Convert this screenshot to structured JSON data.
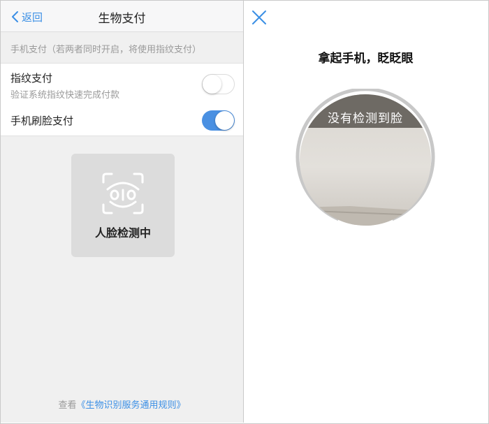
{
  "left_panel": {
    "nav": {
      "back_label": "返回",
      "title": "生物支付"
    },
    "section_hint": "手机支付（若两者同时开启，将使用指纹支付）",
    "fingerprint": {
      "title": "指纹支付",
      "subtitle": "验证系统指纹快速完成付款",
      "enabled": false
    },
    "face": {
      "title": "手机刷脸支付",
      "enabled": true
    },
    "face_card": {
      "icon": "face-scan-icon",
      "label": "人脸检测中"
    },
    "footer": {
      "prefix": "查看",
      "link": "《生物识别服务通用规则》"
    }
  },
  "right_panel": {
    "close_icon": "close-icon",
    "prompt": "拿起手机，眨眨眼",
    "camera_status": "没有检测到脸"
  },
  "colors": {
    "accent": "#3b8fe5",
    "toggle_on": "#4a90e2",
    "panel_bg": "#f0f0f0",
    "card_bg": "#dcdcdc"
  }
}
